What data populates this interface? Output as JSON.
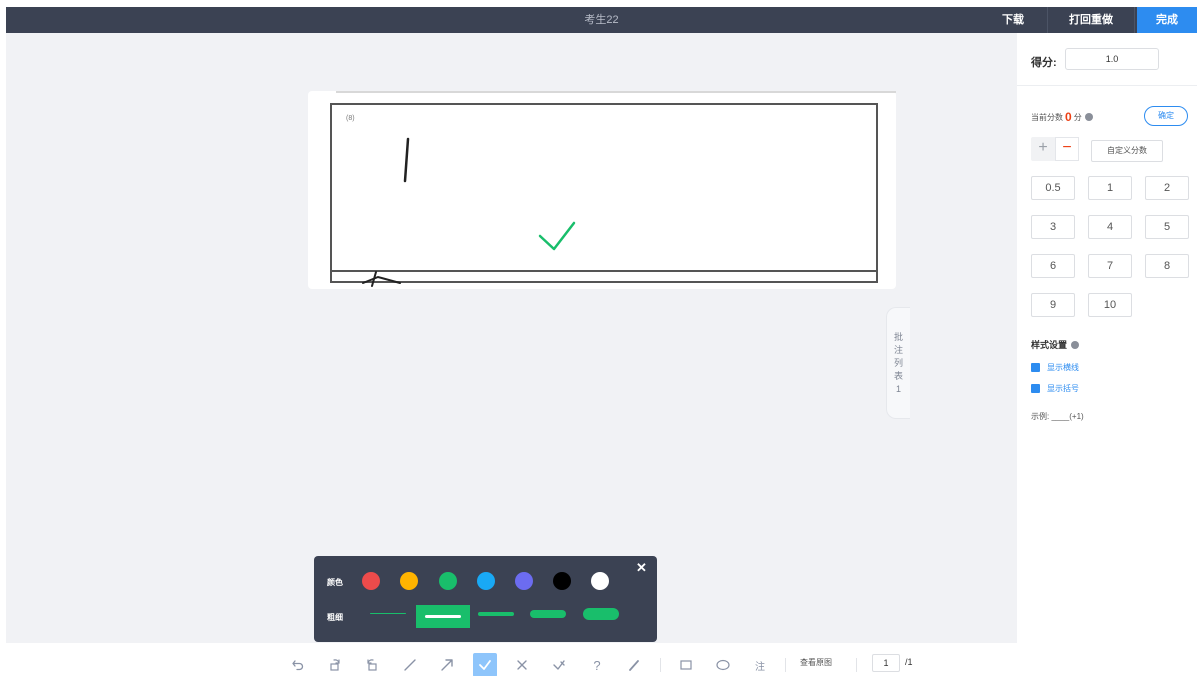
{
  "header": {
    "title": "考生22",
    "download_label": "下载",
    "print_label": "打回重做",
    "finish_label": "完成"
  },
  "paper": {
    "question_number": "(8)"
  },
  "sidetab": {
    "chars": [
      "批",
      "注",
      "列",
      "表",
      "1"
    ]
  },
  "panel": {
    "score_label": "得分:",
    "score_value": "1.0",
    "current_prefix": "当前分数",
    "current_value": "0",
    "current_suffix": "分",
    "confirm_label": "确定",
    "plus_label": "+",
    "minus_label": "−",
    "custom_label": "自定义分数",
    "score_buttons": [
      "0.5",
      "1",
      "2",
      "3",
      "4",
      "5",
      "6",
      "7",
      "8",
      "9",
      "10"
    ],
    "style_title": "样式设置",
    "show_lines_label": "显示横线",
    "show_sign_label": "显示括号",
    "example_label": "示例:  ____(+1)"
  },
  "popup": {
    "color_label": "颜色",
    "thickness_label": "粗细",
    "close_label": "✕",
    "colors": [
      "#ed4b4b",
      "#ffb400",
      "#19be6b",
      "#19a9f5",
      "#6c6cf0",
      "#000000",
      "#ffffff"
    ],
    "selected_thickness": 2
  },
  "toolbar": {
    "note_label": "注",
    "question_label": "?",
    "view_label": "查看原图",
    "page_value": "1",
    "page_total": "/1"
  }
}
